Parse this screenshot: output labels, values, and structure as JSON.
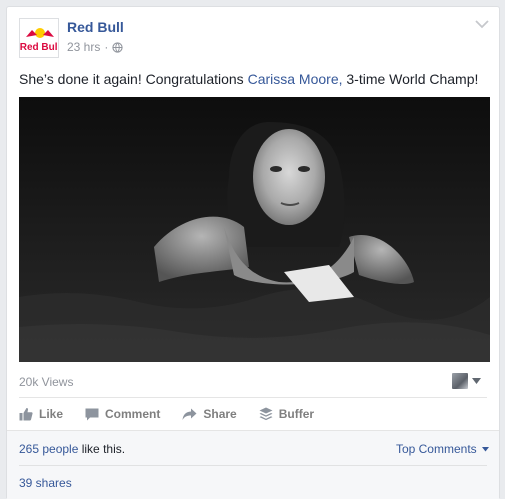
{
  "post": {
    "page_name": "Red Bull",
    "timestamp": "23 hrs",
    "separator": "·",
    "avatar_text": "Red Bull",
    "message_prefix": "She’s done it again! Congratulations ",
    "message_link": "Carissa Moore,",
    "message_suffix": " 3-time World Champ!"
  },
  "stats": {
    "views": "20k Views"
  },
  "actions": {
    "like": "Like",
    "comment": "Comment",
    "share": "Share",
    "buffer": "Buffer"
  },
  "engagement": {
    "likes_link": "265 people",
    "likes_suffix": " like this.",
    "top_comments": "Top Comments",
    "shares": "39 shares"
  },
  "colors": {
    "link": "#365899",
    "meta": "#90949c",
    "brand_red": "#db0a40",
    "brand_yellow": "#ffcc00",
    "brand_navy": "#1e2a53"
  },
  "icons": {
    "privacy": "globe-icon",
    "menu": "chevron-down-icon",
    "like": "thumbs-up-icon",
    "comment": "speech-bubble-icon",
    "share": "share-arrow-icon",
    "buffer": "layers-icon"
  }
}
